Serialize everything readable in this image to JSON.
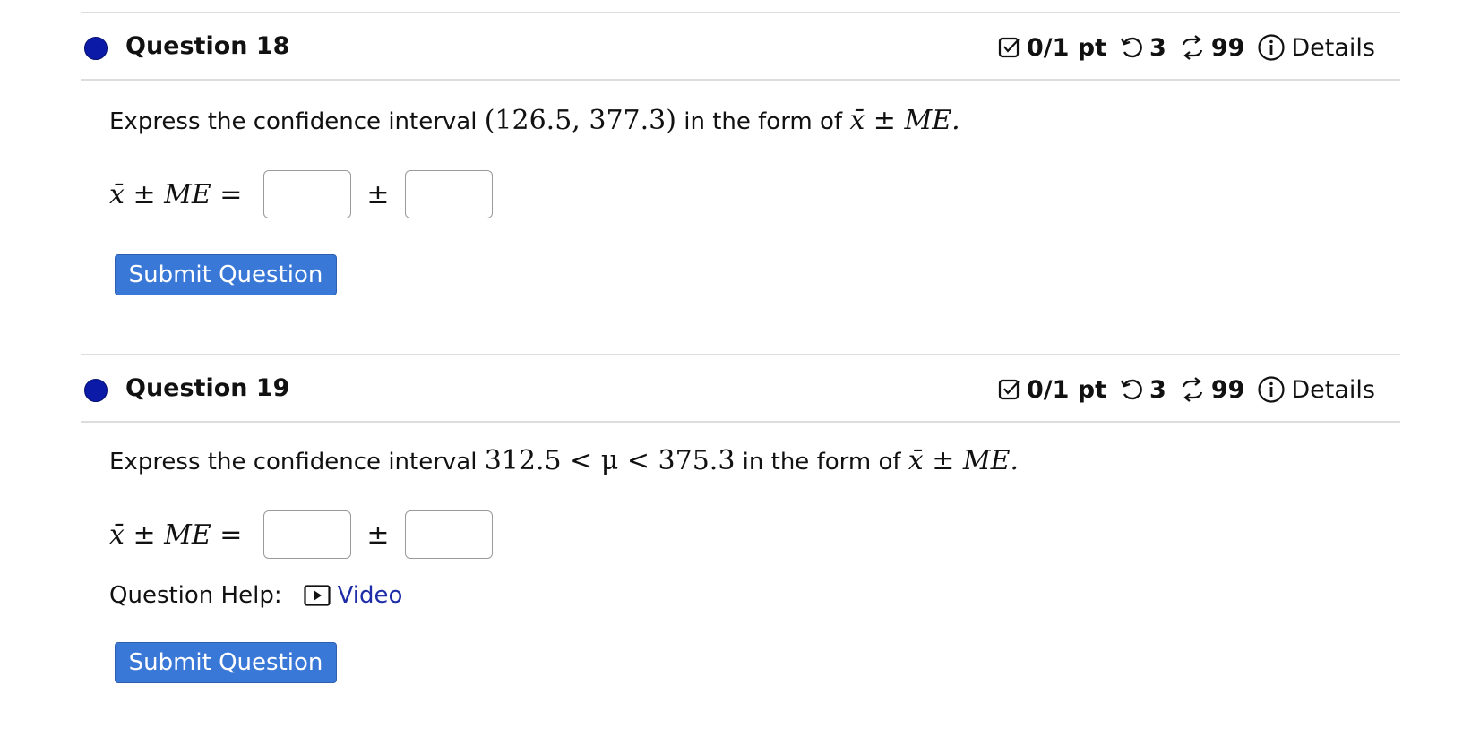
{
  "q18": {
    "title": "Question 18",
    "score": "0/1 pt",
    "retries": "3",
    "attempts": "99",
    "details": "Details",
    "prompt_pre": "Express the confidence interval ",
    "interval": "(126.5, 377.3)",
    "prompt_mid": " in the form of ",
    "form": "x̄ ± ME.",
    "lhs": "x̄ ± ME =",
    "pm": "±",
    "answer1": "",
    "answer2": "",
    "submit_label": "Submit Question"
  },
  "q19": {
    "title": "Question 19",
    "score": "0/1 pt",
    "retries": "3",
    "attempts": "99",
    "details": "Details",
    "prompt_pre": "Express the confidence interval ",
    "interval": "312.5 < μ < 375.3",
    "prompt_mid": " in the form of ",
    "form": "x̄ ± ME.",
    "lhs": "x̄ ± ME =",
    "pm": "±",
    "answer1": "",
    "answer2": "",
    "help_label": "Question Help:",
    "video_label": "Video",
    "submit_label": "Submit Question"
  },
  "icons": {
    "score": "checkbox-icon",
    "retry": "retry-icon",
    "attempts": "attempts-icon",
    "details": "info-icon",
    "video": "video-play-icon"
  },
  "colors": {
    "dot": "#0c1aa8",
    "button": "#3a78d8",
    "link": "#1f2ea8"
  }
}
